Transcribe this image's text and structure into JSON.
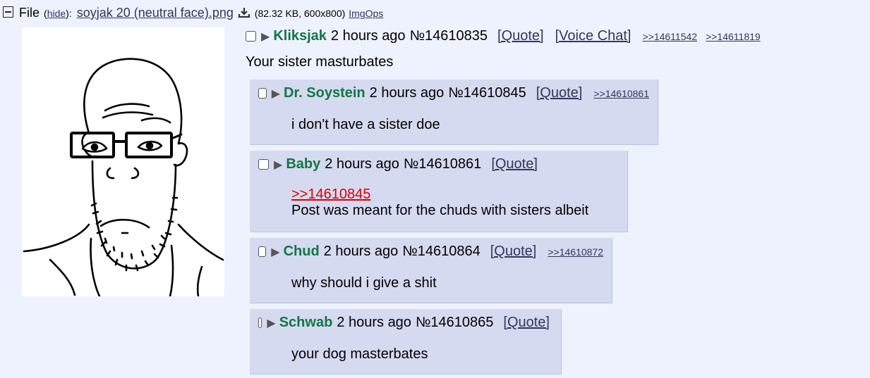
{
  "file": {
    "label": "File",
    "hide": "hide",
    "filename": "soyjak 20 (neutral face).png",
    "info": "(82.32 KB, 600x800)",
    "imgops": "ImgOps"
  },
  "op": {
    "name": "Kliksjak",
    "time": "2 hours ago",
    "number": "№14610835",
    "quote": "[Quote]",
    "voice_chat": "[Voice Chat]",
    "backlinks": [
      ">>14611542",
      ">>14611819"
    ],
    "body": "Your sister masturbates"
  },
  "replies": [
    {
      "name": "Dr. Soystein",
      "time": "2 hours ago",
      "number": "№14610845",
      "quote": "[Quote]",
      "backlinks": [
        ">>14610861"
      ],
      "quotelink": "",
      "body": "i don't have a sister doe"
    },
    {
      "name": "Baby",
      "time": "2 hours ago",
      "number": "№14610861",
      "quote": "[Quote]",
      "backlinks": [],
      "quotelink": ">>14610845",
      "body": "Post was meant for the chuds with sisters albeit"
    },
    {
      "name": "Chud",
      "time": "2 hours ago",
      "number": "№14610864",
      "quote": "[Quote]",
      "backlinks": [
        ">>14610872"
      ],
      "quotelink": "",
      "body": "why should i give a shit"
    },
    {
      "name": "Schwab",
      "time": "2 hours ago",
      "number": "№14610865",
      "quote": "[Quote]",
      "backlinks": [],
      "quotelink": "",
      "body": "your dog masterbates"
    }
  ],
  "colors": {
    "background": "#eef2ff",
    "reply_background": "#d6daf0",
    "name": "#117743",
    "link": "#34345c",
    "quotelink": "#dd0000"
  },
  "icons": {
    "collapse": "collapse-icon",
    "download": "download-icon",
    "expand": "triangle-expand-icon"
  }
}
